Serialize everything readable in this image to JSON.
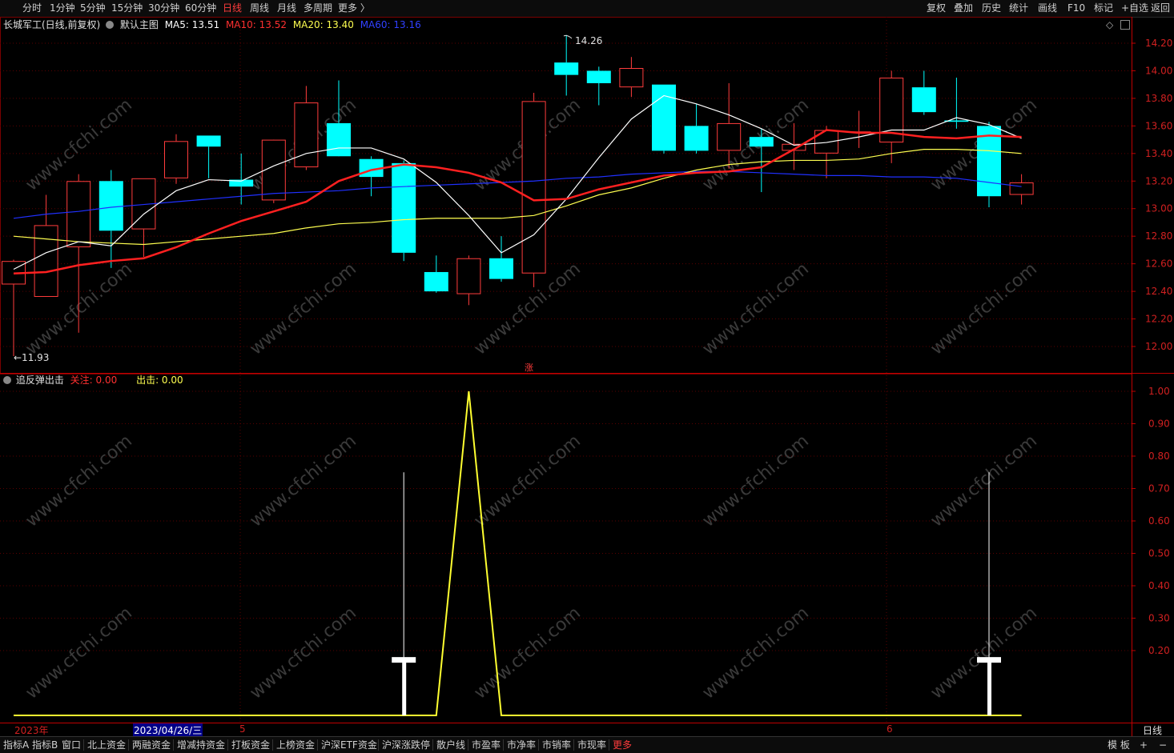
{
  "toolbar": {
    "periods": [
      "分时",
      "1分钟",
      "5分钟",
      "15分钟",
      "30分钟",
      "60分钟",
      "日线",
      "周线",
      "月线",
      "多周期",
      "更多 〉"
    ],
    "active_period": "日线",
    "tools": [
      "复权",
      "叠加",
      "历史",
      "统计",
      "画线",
      "F10",
      "标记",
      "+自选",
      "返回"
    ]
  },
  "main_legend": {
    "stock": "长城军工(日线,前复权)",
    "template": "默认主图",
    "ma5": "MA5: 13.51",
    "ma10": "MA10: 13.52",
    "ma20": "MA20: 13.40",
    "ma60": "MA60: 13.16",
    "high_label": "14.26",
    "low_label": "←11.93",
    "zhang_mark": "涨"
  },
  "indicator_legend": {
    "name": "追反弹出击",
    "guanzhu": "关注: 0.00",
    "chuji": "出击: 0.00"
  },
  "price_axis": [
    "14.20",
    "14.00",
    "13.80",
    "13.60",
    "13.40",
    "13.20",
    "13.00",
    "12.80",
    "12.60",
    "12.40",
    "12.20",
    "12.00"
  ],
  "indicator_axis": [
    "1.00",
    "0.90",
    "0.80",
    "0.70",
    "0.60",
    "0.50",
    "0.40",
    "0.30",
    "0.20"
  ],
  "date_axis": {
    "year": "2023年",
    "cursor_date": "2023/04/26/三",
    "may": "5",
    "june": "6",
    "period_label": "日线"
  },
  "watermark": "www.cfchi.com",
  "colors": {
    "up": "#ff3c3c",
    "down": "#00ffff",
    "ma5": "#ffffff",
    "ma10": "#ff2020",
    "ma20": "#ffff50",
    "ma60": "#2030ff",
    "grid": "#5a0000",
    "axis_text": "#d02020"
  },
  "chart_data": {
    "type": "candlestick",
    "price_ylim": [
      11.85,
      14.4
    ],
    "indicator_ylim": [
      0,
      1.0
    ],
    "candles": [
      {
        "o": 12.45,
        "h": 12.63,
        "l": 11.93,
        "c": 12.62
      },
      {
        "o": 12.36,
        "h": 13.1,
        "l": 12.36,
        "c": 12.88
      },
      {
        "o": 12.72,
        "h": 13.25,
        "l": 12.1,
        "c": 13.2
      },
      {
        "o": 13.2,
        "h": 13.28,
        "l": 12.57,
        "c": 12.84
      },
      {
        "o": 12.85,
        "h": 13.22,
        "l": 12.65,
        "c": 13.22
      },
      {
        "o": 13.22,
        "h": 13.54,
        "l": 13.18,
        "c": 13.49
      },
      {
        "o": 13.53,
        "h": 13.53,
        "l": 13.22,
        "c": 13.45
      },
      {
        "o": 13.21,
        "h": 13.4,
        "l": 13.03,
        "c": 13.16
      },
      {
        "o": 13.06,
        "h": 13.47,
        "l": 13.04,
        "c": 13.5
      },
      {
        "o": 13.3,
        "h": 13.89,
        "l": 13.28,
        "c": 13.77
      },
      {
        "o": 13.62,
        "h": 13.93,
        "l": 13.39,
        "c": 13.38
      },
      {
        "o": 13.36,
        "h": 13.38,
        "l": 13.09,
        "c": 13.23
      },
      {
        "o": 13.33,
        "h": 13.35,
        "l": 12.62,
        "c": 12.68
      },
      {
        "o": 12.54,
        "h": 12.66,
        "l": 12.39,
        "c": 12.4
      },
      {
        "o": 12.38,
        "h": 12.66,
        "l": 12.3,
        "c": 12.64
      },
      {
        "o": 12.64,
        "h": 12.8,
        "l": 12.47,
        "c": 12.49
      },
      {
        "o": 12.53,
        "h": 13.84,
        "l": 12.43,
        "c": 13.78
      },
      {
        "o": 14.06,
        "h": 14.26,
        "l": 13.82,
        "c": 13.97
      },
      {
        "o": 14.0,
        "h": 14.03,
        "l": 13.75,
        "c": 13.91
      },
      {
        "o": 13.88,
        "h": 14.1,
        "l": 13.81,
        "c": 14.02
      },
      {
        "o": 13.9,
        "h": 13.9,
        "l": 13.4,
        "c": 13.42
      },
      {
        "o": 13.6,
        "h": 13.76,
        "l": 13.4,
        "c": 13.42
      },
      {
        "o": 13.42,
        "h": 13.91,
        "l": 13.29,
        "c": 13.62
      },
      {
        "o": 13.52,
        "h": 13.58,
        "l": 13.12,
        "c": 13.45
      },
      {
        "o": 13.42,
        "h": 13.62,
        "l": 13.28,
        "c": 13.47
      },
      {
        "o": 13.4,
        "h": 13.6,
        "l": 13.22,
        "c": 13.57
      },
      {
        "o": 13.55,
        "h": 13.71,
        "l": 13.44,
        "c": 13.56
      },
      {
        "o": 13.48,
        "h": 14.0,
        "l": 13.33,
        "c": 13.95
      },
      {
        "o": 13.88,
        "h": 14.0,
        "l": 13.68,
        "c": 13.7
      },
      {
        "o": 13.64,
        "h": 13.95,
        "l": 13.58,
        "c": 13.63
      },
      {
        "o": 13.6,
        "h": 13.63,
        "l": 13.01,
        "c": 13.09
      },
      {
        "o": 13.1,
        "h": 13.25,
        "l": 13.03,
        "c": 13.19
      }
    ],
    "ma5": [
      12.56,
      12.68,
      12.76,
      12.73,
      12.96,
      13.13,
      13.21,
      13.2,
      13.31,
      13.4,
      13.44,
      13.44,
      13.36,
      13.19,
      12.95,
      12.68,
      12.81,
      13.07,
      13.37,
      13.65,
      13.82,
      13.76,
      13.68,
      13.58,
      13.46,
      13.48,
      13.52,
      13.57,
      13.57,
      13.66,
      13.61,
      13.51
    ],
    "ma10": [
      12.53,
      12.54,
      12.59,
      12.62,
      12.64,
      12.72,
      12.82,
      12.91,
      12.98,
      13.05,
      13.2,
      13.28,
      13.32,
      13.3,
      13.26,
      13.19,
      13.06,
      13.07,
      13.14,
      13.19,
      13.24,
      13.26,
      13.27,
      13.3,
      13.43,
      13.57,
      13.55,
      13.55,
      13.52,
      13.51,
      13.53,
      13.52
    ],
    "ma20": [
      12.8,
      12.78,
      12.76,
      12.75,
      12.74,
      12.76,
      12.78,
      12.8,
      12.82,
      12.86,
      12.89,
      12.9,
      12.92,
      12.93,
      12.93,
      12.93,
      12.95,
      13.02,
      13.1,
      13.15,
      13.22,
      13.28,
      13.32,
      13.34,
      13.35,
      13.35,
      13.36,
      13.4,
      13.43,
      13.43,
      13.42,
      13.4
    ],
    "ma60": [
      12.93,
      12.96,
      12.98,
      13.01,
      13.03,
      13.05,
      13.07,
      13.09,
      13.11,
      13.12,
      13.13,
      13.15,
      13.16,
      13.17,
      13.18,
      13.19,
      13.2,
      13.22,
      13.23,
      13.25,
      13.26,
      13.27,
      13.27,
      13.26,
      13.25,
      13.24,
      13.24,
      13.23,
      13.23,
      13.22,
      13.19,
      13.16
    ],
    "guanzhu": [
      0,
      0,
      0,
      0,
      0,
      0,
      0,
      0,
      0,
      0,
      0,
      0,
      0,
      0,
      1,
      0,
      0,
      0,
      0,
      0,
      0,
      0,
      0,
      0,
      0,
      0,
      0,
      0,
      0,
      0,
      0,
      0
    ],
    "chuji_signal_bars": [
      12,
      30
    ]
  }
}
